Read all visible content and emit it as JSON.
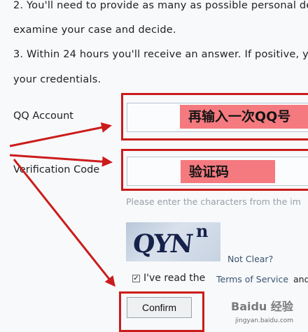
{
  "instructions": {
    "line1": "2. You'll need to provide as many as possible personal de",
    "line2": "examine your case and decide.",
    "line3": "3. Within 24 hours you'll receive an answer. If positive, yo",
    "line4": "your credentials."
  },
  "form": {
    "qq_label": "QQ Account",
    "qq_overlay_text": "再输入一次QQ号",
    "verification_label": "Verification Code",
    "verification_overlay_text": "验证码",
    "hint": "Please enter the characters from the im",
    "captcha_text": "QYN",
    "captcha_sup": "n",
    "not_clear_link": "Not Clear?",
    "checkbox_checked": true,
    "terms_prefix": "I've read the",
    "terms_link": "Terms of Service",
    "terms_suffix": "and",
    "confirm_label": "Confirm"
  },
  "watermark": {
    "brand": "Baidu 经验",
    "url": "jingyan.baidu.com"
  },
  "colors": {
    "annotation_red": "#cc1b1b",
    "overlay_pink": "#f47a7f"
  }
}
